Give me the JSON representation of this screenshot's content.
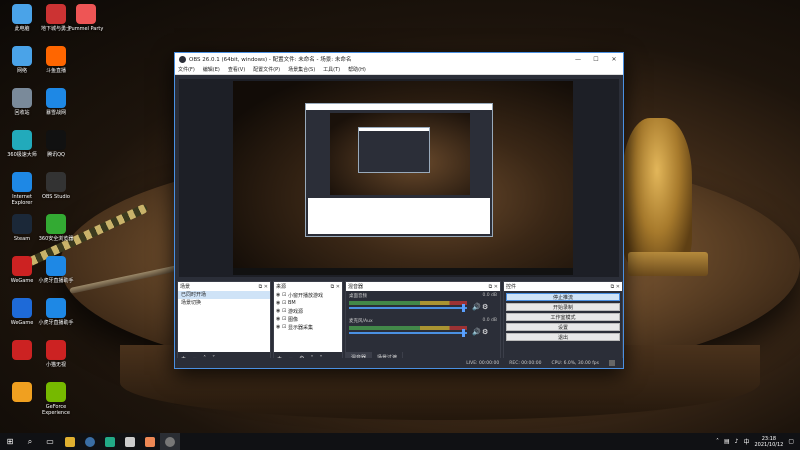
{
  "desktop_icons": [
    {
      "label": "此电脑",
      "color": "#4aa3e8"
    },
    {
      "label": "地下城与勇士",
      "color": "#c33"
    },
    {
      "label": "Pummel Party",
      "color": "#e55"
    },
    {
      "label": "网络",
      "color": "#4aa3e8"
    },
    {
      "label": "斗鱼直播",
      "color": "#f60"
    },
    {
      "label": "回收站",
      "color": "#7a8a9a"
    },
    {
      "label": "暴雪战网",
      "color": "#1e88e5"
    },
    {
      "label": "360极速大师",
      "color": "#2ab"
    },
    {
      "label": "腾讯QQ",
      "color": "#111"
    },
    {
      "label": "Internet Explorer",
      "color": "#1e88e5"
    },
    {
      "label": "OBS Studio",
      "color": "#333"
    },
    {
      "label": "Steam",
      "color": "#1b2838"
    },
    {
      "label": "360安全浏览器",
      "color": "#3a3"
    },
    {
      "label": "WeGame",
      "color": "#c22"
    },
    {
      "label": "小虎牙直播助手",
      "color": "#1e88e5"
    },
    {
      "label": "WeGame",
      "color": "#1e6ad8"
    },
    {
      "label": "小虎牙直播助手",
      "color": "#1e88e5"
    },
    {
      "label": "",
      "color": "#c22"
    },
    {
      "label": "小猫无视",
      "color": "#c22"
    },
    {
      "label": "",
      "color": "#f0a020"
    },
    {
      "label": "GeForce Experience",
      "color": "#76b900"
    }
  ],
  "obs": {
    "title": "OBS 26.0.1 (64bit, windows) - 配置文件: 未命名 - 场景: 未命名",
    "minimize": "—",
    "maximize": "☐",
    "close": "✕",
    "menu": [
      "文件(F)",
      "编辑(E)",
      "查看(V)",
      "配置文件(P)",
      "场景集合(S)",
      "工具(T)",
      "帮助(H)"
    ],
    "scenes": {
      "header": "场景",
      "items": [
        "已同时开场",
        "场景切换"
      ]
    },
    "sources": {
      "header": "来源",
      "items": [
        "小窗开播放游戏",
        "BM",
        "游戏源",
        "图像",
        "显示器采集"
      ]
    },
    "mixer": {
      "header": "混音器",
      "tracks": [
        {
          "name": "桌面音频",
          "db": "0.0 dB"
        },
        {
          "name": "麦克风/Aux",
          "db": "0.0 dB"
        }
      ],
      "tabs": [
        "混音器",
        "场景过渡"
      ]
    },
    "controls": {
      "header": "控件",
      "buttons": [
        "停止推流",
        "开始录制",
        "工作室模式",
        "设置",
        "退出"
      ]
    },
    "status": {
      "live": "LIVE: 00:00:00",
      "rec": "REC: 00:00:00",
      "cpu": "CPU: 6.0%, 30.00 fps"
    }
  },
  "taskbar": {
    "start": "⊞",
    "search": "⌕",
    "time": "23:18",
    "date": "2021/10/12"
  }
}
